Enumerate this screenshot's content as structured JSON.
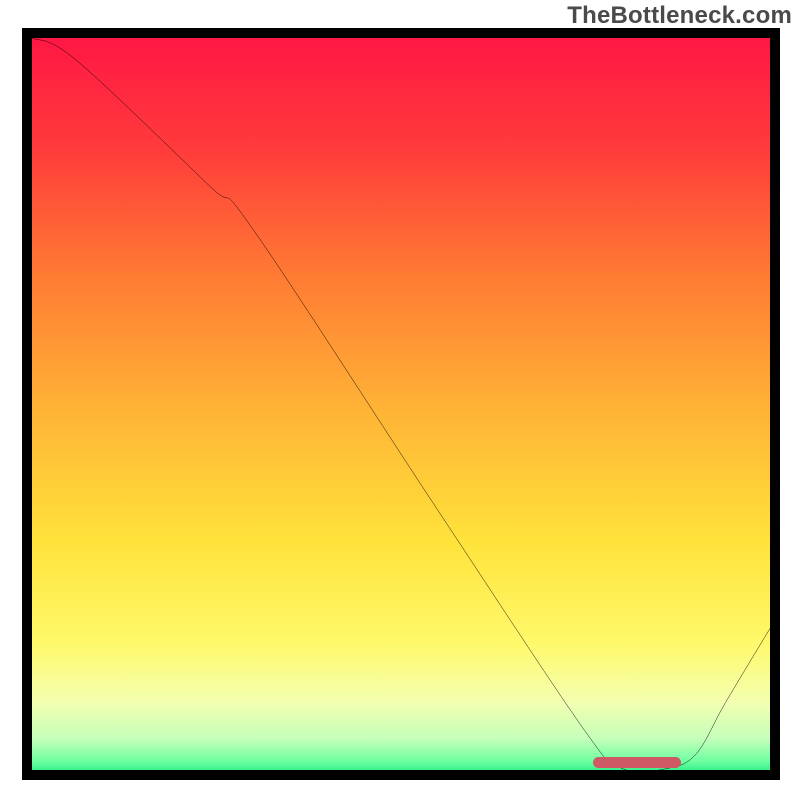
{
  "watermark": "TheBottleneck.com",
  "chart_data": {
    "type": "line",
    "title": "",
    "xlabel": "",
    "ylabel": "",
    "xlim": [
      0,
      100
    ],
    "ylim": [
      0,
      100
    ],
    "x": [
      0,
      6,
      24,
      30,
      55,
      75,
      80,
      86,
      90,
      94,
      100
    ],
    "values": [
      100,
      97,
      80,
      74,
      36,
      6,
      1,
      1,
      3,
      10,
      20
    ],
    "optimum_range_x": [
      76,
      88
    ],
    "gradient_stops": [
      {
        "pct": 0,
        "color": "#ff1744"
      },
      {
        "pct": 15,
        "color": "#ff3b3b"
      },
      {
        "pct": 32,
        "color": "#ff7a33"
      },
      {
        "pct": 50,
        "color": "#ffb236"
      },
      {
        "pct": 68,
        "color": "#ffe23a"
      },
      {
        "pct": 82,
        "color": "#fff96b"
      },
      {
        "pct": 90,
        "color": "#f3ffb0"
      },
      {
        "pct": 95,
        "color": "#c4ffba"
      },
      {
        "pct": 98,
        "color": "#6dffa0"
      },
      {
        "pct": 100,
        "color": "#19e880"
      }
    ],
    "optimum_marker_color": "#cf5865"
  }
}
